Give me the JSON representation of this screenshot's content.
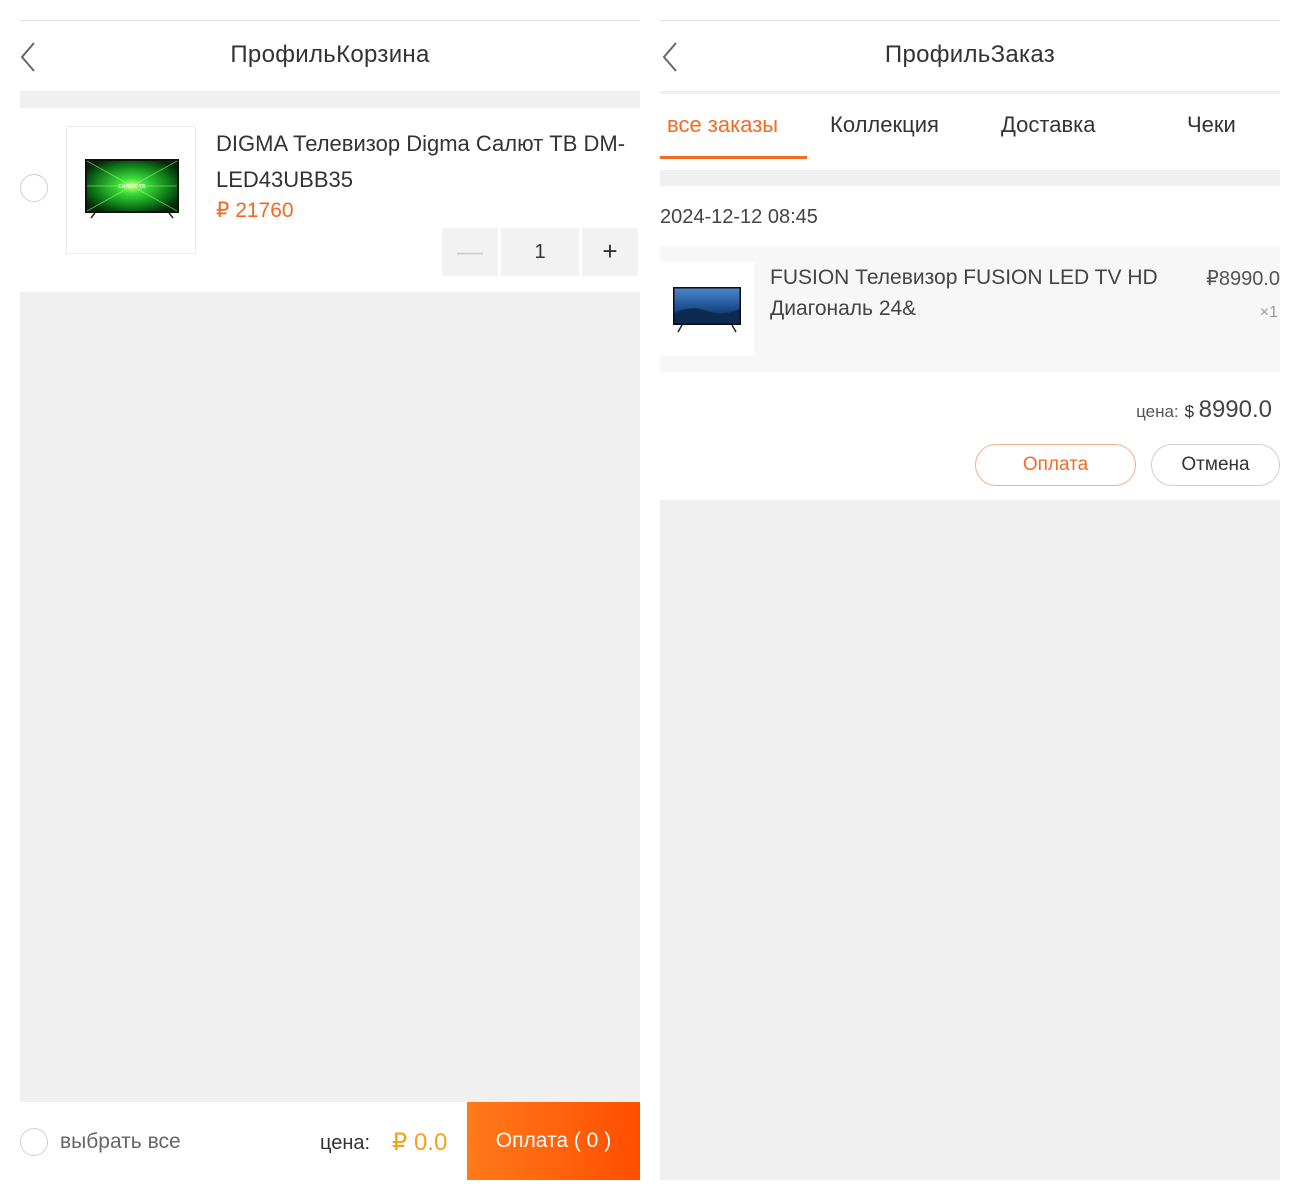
{
  "cart": {
    "title": "ПрофильКорзина",
    "item": {
      "name": "DIGMA Телевизор Digma Салют ТВ DM-LED43UBB35",
      "price": "₽ 21760",
      "quantity": "1",
      "minus_label": "—",
      "plus_label": "+",
      "tv_screen_text": "САЛЮТ ТВ"
    },
    "footer": {
      "select_all": "выбрать все",
      "total_label": "цена:",
      "total_value": "₽ 0.0",
      "pay_button": "Оплата ( 0 )"
    }
  },
  "orders": {
    "title": "ПрофильЗаказ",
    "tabs": [
      {
        "label": "все заказы",
        "active": true
      },
      {
        "label": "Коллекция",
        "active": false
      },
      {
        "label": "Доставка",
        "active": false
      },
      {
        "label": "Чеки",
        "active": false
      }
    ],
    "order": {
      "date": "2024-12-12 08:45",
      "item_name": "FUSION Телевизор FUSION LED TV HD Диагональ 24&",
      "item_price": "₽8990.0",
      "item_qty": "×1",
      "total_label": "цена:",
      "total_currency": "$",
      "total_value": "8990.0",
      "pay_button": "Оплата",
      "cancel_button": "Отмена"
    }
  },
  "colors": {
    "accent": "#f26b21",
    "total_price": "#f7a115",
    "background": "#f0f0f0"
  },
  "icons": [
    "chevron-left-icon",
    "radio-unchecked-icon",
    "tv-product-image"
  ]
}
